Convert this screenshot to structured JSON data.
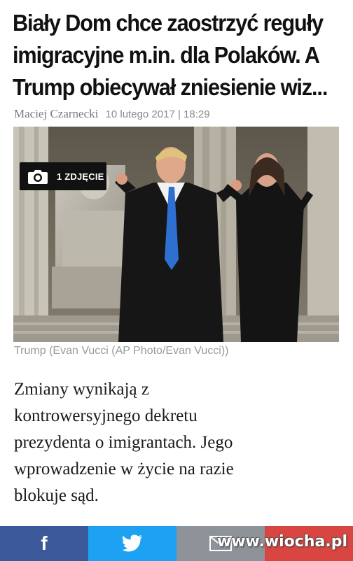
{
  "article": {
    "headline_lines": [
      "Biały Dom chce zaostrzyć reguły",
      "imigracyjne m.in. dla Polaków. A",
      "Trump obiecywał zniesienie wiz..."
    ],
    "author": "Maciej Czarnecki",
    "date": "10 lutego 2017 | 18:29",
    "photo_badge": "1 ZDJĘCIE",
    "photo_caption": "Trump (Evan Vucci (AP Photo/Evan Vucci))",
    "lead_lines": [
      "Zmiany wynikają z",
      "kontrowersyjnego dekretu",
      "prezydenta o imigrantach. Jego",
      "wprowadzenie w życie na razie",
      "blokuje sąd."
    ]
  },
  "share": {
    "facebook_icon": "f",
    "twitter_icon": "twitter-bird-icon",
    "mail_icon": "mail-icon"
  },
  "watermark": "www.wiocha.pl",
  "colors": {
    "facebook": "#3b5998",
    "twitter": "#1da1f2",
    "mail": "#8d9399",
    "red": "#d94642"
  }
}
